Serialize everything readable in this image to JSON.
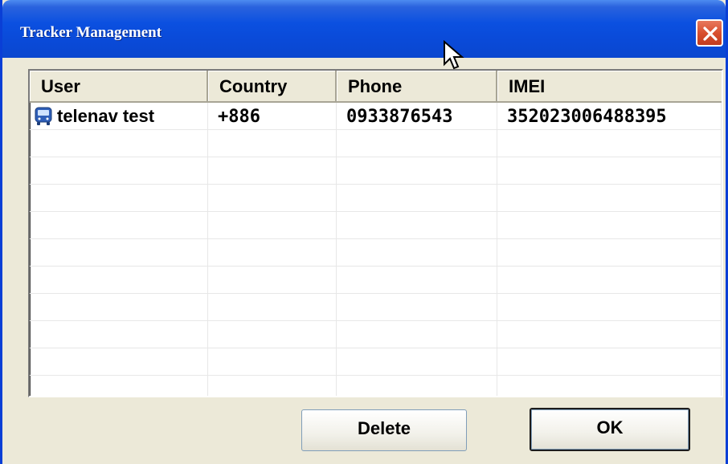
{
  "window": {
    "title": "Tracker Management"
  },
  "listview": {
    "columns": [
      "User",
      "Country",
      "Phone",
      "IMEI"
    ],
    "rows": [
      {
        "user": "telenav test",
        "country": "+886",
        "phone": "0933876543",
        "imei": "352023006488395",
        "icon": "bus-icon"
      }
    ],
    "empty_row_count": 10
  },
  "buttons": {
    "delete_label": "Delete",
    "ok_label": "OK"
  },
  "colors": {
    "titlebar": "#0a4ad8",
    "close_button": "#d9502f",
    "dialog_bg": "#ece9d8"
  }
}
